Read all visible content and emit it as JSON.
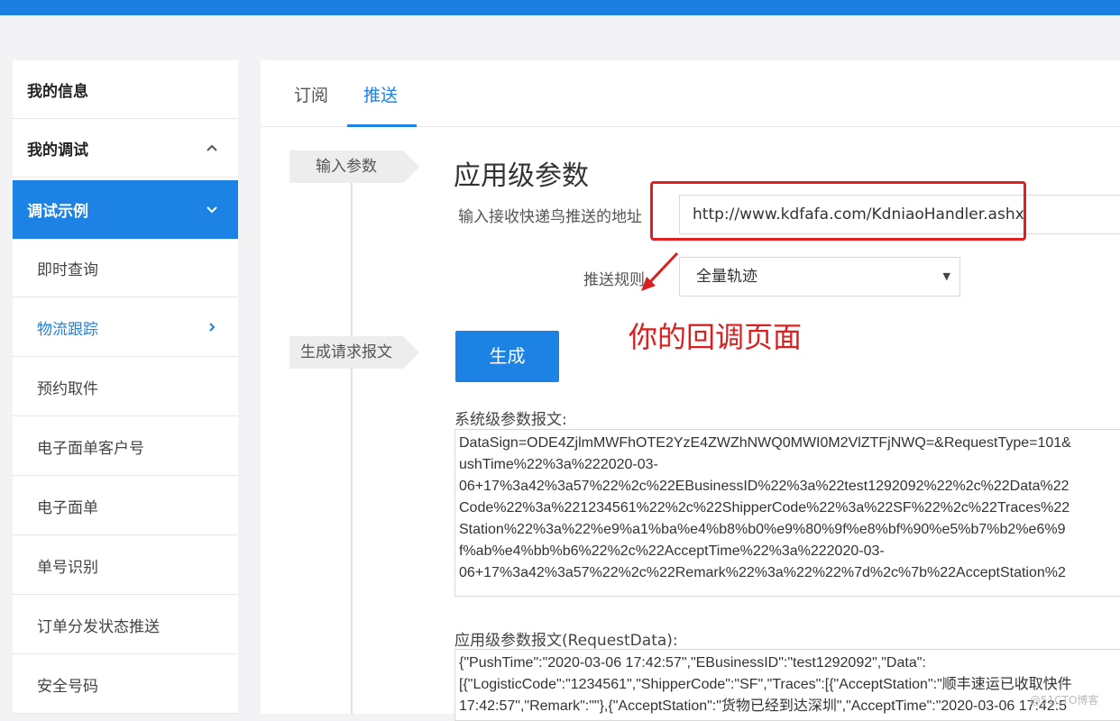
{
  "sidebar": {
    "items": [
      {
        "label": "我的信息"
      },
      {
        "label": "我的调试"
      },
      {
        "label": "调试示例"
      },
      {
        "label": "即时查询"
      },
      {
        "label": "物流跟踪"
      },
      {
        "label": "预约取件"
      },
      {
        "label": "电子面单客户号"
      },
      {
        "label": "电子面单"
      },
      {
        "label": "单号识别"
      },
      {
        "label": "订单分发状态推送"
      },
      {
        "label": "安全号码"
      }
    ]
  },
  "tabs": [
    {
      "label": "订阅"
    },
    {
      "label": "推送"
    }
  ],
  "steps": {
    "input": "输入参数",
    "generate": "生成请求报文"
  },
  "form": {
    "title": "应用级参数",
    "url_label": "输入接收快递鸟推送的地址",
    "url_value": "http://www.kdfafa.com/KdniaoHandler.ashx",
    "rule_label": "推送规则",
    "rule_value": "全量轨迹",
    "generate_button": "生成"
  },
  "annotation": {
    "note": "你的回调页面",
    "color": "#d92020"
  },
  "system_params": {
    "label": "系统级参数报文:",
    "text": "DataSign=ODE4ZjlmMWFhOTE2YzE4ZWZhNWQ0MWI0M2VlZTFjNWQ=&RequestType=101&\nushTime%22%3a%222020-03-\n06+17%3a42%3a57%22%2c%22EBusinessID%22%3a%22test1292092%22%2c%22Data%22\nCode%22%3a%221234561%22%2c%22ShipperCode%22%3a%22SF%22%2c%22Traces%22\nStation%22%3a%22%e9%a1%ba%e4%b8%b0%e9%80%9f%e8%bf%90%e5%b7%b2%e6%9\nf%ab%e4%bb%b6%22%2c%22AcceptTime%22%3a%222020-03-\n06+17%3a42%3a57%22%2c%22Remark%22%3a%22%22%7d%2c%7b%22AcceptStation%2"
  },
  "app_params": {
    "label": "应用级参数报文(RequestData):",
    "text": "{\"PushTime\":\"2020-03-06 17:42:57\",\"EBusinessID\":\"test1292092\",\"Data\":\n[{\"LogisticCode\":\"1234561\",\"ShipperCode\":\"SF\",\"Traces\":[{\"AcceptStation\":\"顺丰速运已收取快件\n17:42:57\",\"Remark\":\"\"},{\"AcceptStation\":\"货物已经到达深圳\",\"AcceptTime\":\"2020-03-06 17:42:5"
  },
  "watermark": "@51CTO博客",
  "colors": {
    "accent": "#1c82e3",
    "topbar": "#1a7fe0"
  }
}
